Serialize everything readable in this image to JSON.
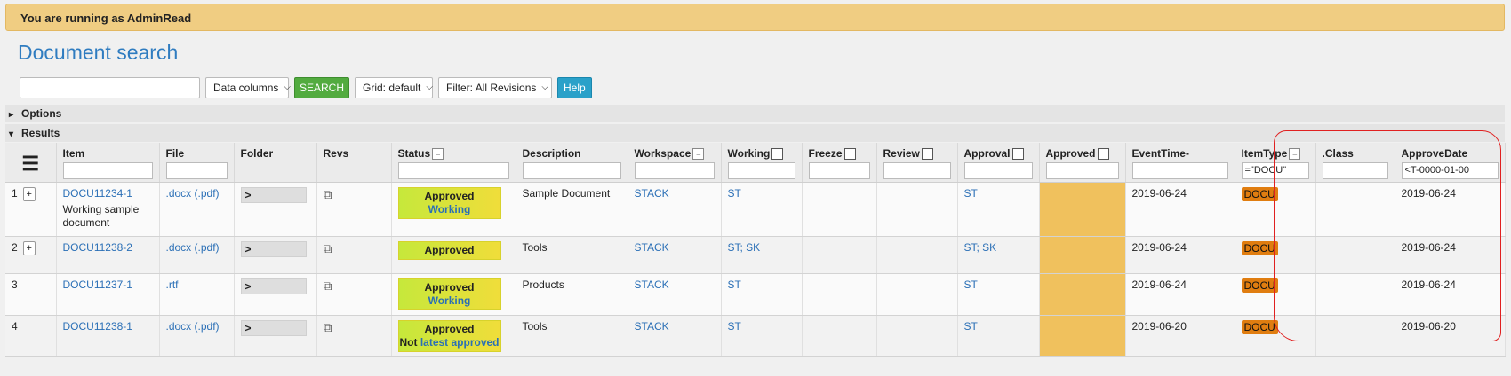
{
  "banner": {
    "text": "You are running as AdminRead"
  },
  "page": {
    "title": "Document search"
  },
  "toolbar": {
    "search_value": "",
    "data_columns": "Data columns",
    "search_label": "SEARCH",
    "grid": "Grid: default",
    "filter": "Filter: All Revisions",
    "help_label": "Help"
  },
  "sections": {
    "options": "Options",
    "results": "Results"
  },
  "columns": {
    "item": "Item",
    "file": "File",
    "folder": "Folder",
    "revs": "Revs",
    "status": "Status",
    "description": "Description",
    "workspace": "Workspace",
    "working": "Working",
    "freeze": "Freeze",
    "review": "Review",
    "approval": "Approval",
    "approved": "Approved",
    "eventtime": "EventTime-",
    "itemtype": "ItemType",
    "class": ".Class",
    "approvedate": "ApproveDate"
  },
  "filters": {
    "itemtype": "=\"DOCU\"",
    "approvedate": "<T-0000-01-00"
  },
  "rows": [
    {
      "num": "1",
      "item": "DOCU11234-1",
      "item_desc": "Working sample document",
      "file": ".docx (.pdf)",
      "folder": ">",
      "status": "Approved",
      "status_sub": "Working",
      "description": "Sample Document",
      "workspace": "STACK",
      "working": "ST",
      "freeze": "",
      "review": "",
      "approval": "ST",
      "eventtime": "2019-06-24",
      "itemtype": "DOCU",
      "class": "",
      "approvedate": "2019-06-24"
    },
    {
      "num": "2",
      "item": "DOCU11238-2",
      "item_desc": "",
      "file": ".docx (.pdf)",
      "folder": ">",
      "status": "Approved",
      "status_sub": "",
      "description": "Tools",
      "workspace": "STACK",
      "working": "ST; SK",
      "freeze": "",
      "review": "",
      "approval": "ST; SK",
      "eventtime": "2019-06-24",
      "itemtype": "DOCU",
      "class": "",
      "approvedate": "2019-06-24"
    },
    {
      "num": "3",
      "item": "DOCU11237-1",
      "item_desc": "",
      "file": ".rtf",
      "folder": ">",
      "status": "Approved",
      "status_sub": "Working",
      "description": "Products",
      "workspace": "STACK",
      "working": "ST",
      "freeze": "",
      "review": "",
      "approval": "ST",
      "eventtime": "2019-06-24",
      "itemtype": "DOCU",
      "class": "",
      "approvedate": "2019-06-24"
    },
    {
      "num": "4",
      "item": "DOCU11238-1",
      "item_desc": "",
      "file": ".docx (.pdf)",
      "folder": ">",
      "status": "Approved",
      "status_prefix": "Not ",
      "status_sub": "latest approved",
      "description": "Tools",
      "workspace": "STACK",
      "working": "ST",
      "freeze": "",
      "review": "",
      "approval": "ST",
      "eventtime": "2019-06-20",
      "itemtype": "DOCU",
      "class": "",
      "approvedate": "2019-06-20"
    }
  ],
  "colors": {
    "banner": "#f0cd82",
    "title": "#2f7cc0",
    "approved_cell": "#f0c15d",
    "docu_badge": "#e07d10",
    "annotation": "#e02020"
  }
}
